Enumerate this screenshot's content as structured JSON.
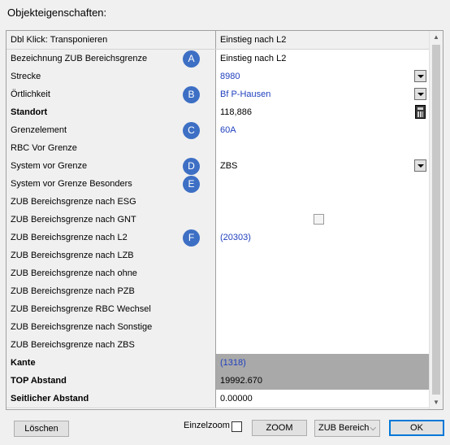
{
  "window": {
    "title": "Objekteigenschaften:"
  },
  "grid": {
    "rows": [
      {
        "label": "Dbl Klick: Transponieren",
        "value": "Einstieg nach L2"
      },
      {
        "label": "Bezeichnung ZUB Bereichsgrenze",
        "value": "Einstieg nach L2"
      },
      {
        "label": "Strecke",
        "value": "8980"
      },
      {
        "label": "Örtlichkeit",
        "value": "Bf P-Hausen"
      },
      {
        "label": "Standort",
        "value": "118,886"
      },
      {
        "label": "Grenzelement",
        "value": "60A"
      },
      {
        "label": "RBC Vor Grenze",
        "value": ""
      },
      {
        "label": "System vor Grenze",
        "value": "ZBS"
      },
      {
        "label": "System vor Grenze Besonders",
        "value": ""
      },
      {
        "label": "ZUB Bereichsgrenze nach ESG",
        "value": ""
      },
      {
        "label": "ZUB Bereichsgrenze nach GNT",
        "value": ""
      },
      {
        "label": "ZUB Bereichsgrenze nach L2",
        "value": "(20303)"
      },
      {
        "label": "ZUB Bereichsgrenze nach LZB",
        "value": ""
      },
      {
        "label": "ZUB Bereichsgrenze nach ohne",
        "value": ""
      },
      {
        "label": "ZUB Bereichsgrenze nach PZB",
        "value": ""
      },
      {
        "label": "ZUB Bereichsgrenze RBC Wechsel",
        "value": ""
      },
      {
        "label": "ZUB Bereichsgrenze nach Sonstige",
        "value": ""
      },
      {
        "label": "ZUB Bereichsgrenze nach ZBS",
        "value": ""
      },
      {
        "label": "Kante",
        "value": "(1318)"
      },
      {
        "label": "TOP Abstand",
        "value": "19992.670"
      },
      {
        "label": "Seitlicher Abstand",
        "value": "0.00000"
      }
    ],
    "gnt_checked": false
  },
  "annotations": [
    "A",
    "B",
    "C",
    "D",
    "E",
    "F"
  ],
  "footer": {
    "delete_label": "Löschen",
    "einzelzoom_label": "Einzelzoom",
    "zoom_label": "ZOOM",
    "select_value": "ZUB Bereich",
    "ok_label": "OK"
  },
  "colors": {
    "link_text": "#1f3fbf",
    "annotation_badge": "#3d6fc4",
    "readonly_cell": "#a9a9a9"
  }
}
